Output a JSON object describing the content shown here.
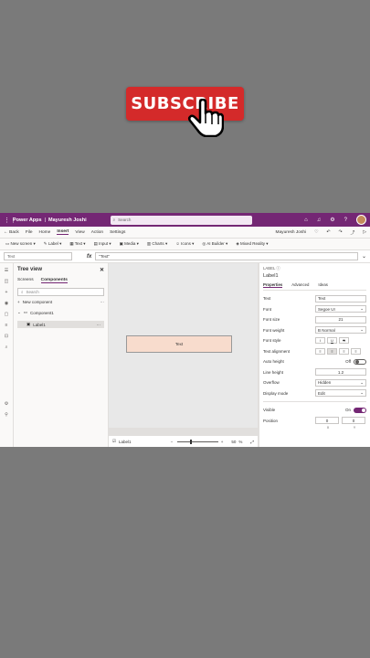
{
  "overlay": {
    "subscribe_label": "SUBSCRIBE"
  },
  "app": {
    "name": "Power Apps",
    "separator": "|",
    "env_user": "Mayuresh Joshi",
    "search_placeholder": "Search"
  },
  "menubar": {
    "back": "Back",
    "items": [
      "File",
      "Home",
      "Insert",
      "View",
      "Action",
      "Settings"
    ],
    "active": "Insert",
    "user": "Mayuresh Joshi"
  },
  "toolbar": {
    "items": [
      "New screen",
      "Label",
      "Text",
      "Input",
      "Media",
      "Charts",
      "Icons",
      "AI Builder",
      "Mixed Reality"
    ]
  },
  "formula": {
    "property": "Text",
    "fx": "fx",
    "expression": "\"Text\""
  },
  "tree": {
    "title": "Tree view",
    "tabs": [
      "Screens",
      "Components"
    ],
    "active_tab": "Components",
    "search_placeholder": "Search",
    "new_component": "New component",
    "component": "Component1",
    "child": "Label1"
  },
  "canvas": {
    "label_text": "Text",
    "status_label": "Label1",
    "zoom_value": "50",
    "zoom_unit": "%"
  },
  "props": {
    "type": "LABEL",
    "name": "Label1",
    "tabs": [
      "Properties",
      "Advanced",
      "Ideas"
    ],
    "active_tab": "Properties",
    "rows": {
      "text_label": "Text",
      "text_value": "Text",
      "font_label": "Font",
      "font_value": "Segoe UI",
      "font_size_label": "Font size",
      "font_size_value": "21",
      "font_weight_label": "Font weight",
      "font_weight_value": "B  Normal",
      "font_style_label": "Font style",
      "text_align_label": "Text alignment",
      "auto_height_label": "Auto height",
      "auto_height_value": "Off",
      "line_height_label": "Line height",
      "line_height_value": "1.2",
      "overflow_label": "Overflow",
      "overflow_value": "Hidden",
      "display_mode_label": "Display mode",
      "display_mode_value": "Edit",
      "visible_label": "Visible",
      "visible_value": "On",
      "position_label": "Position",
      "position_x": "0",
      "position_y": "0",
      "x_label": "X",
      "y_label": "Y"
    }
  },
  "colors": {
    "brand": "#742774",
    "subscribe_red": "#d42a2a",
    "label_fill": "#f8dccd"
  }
}
